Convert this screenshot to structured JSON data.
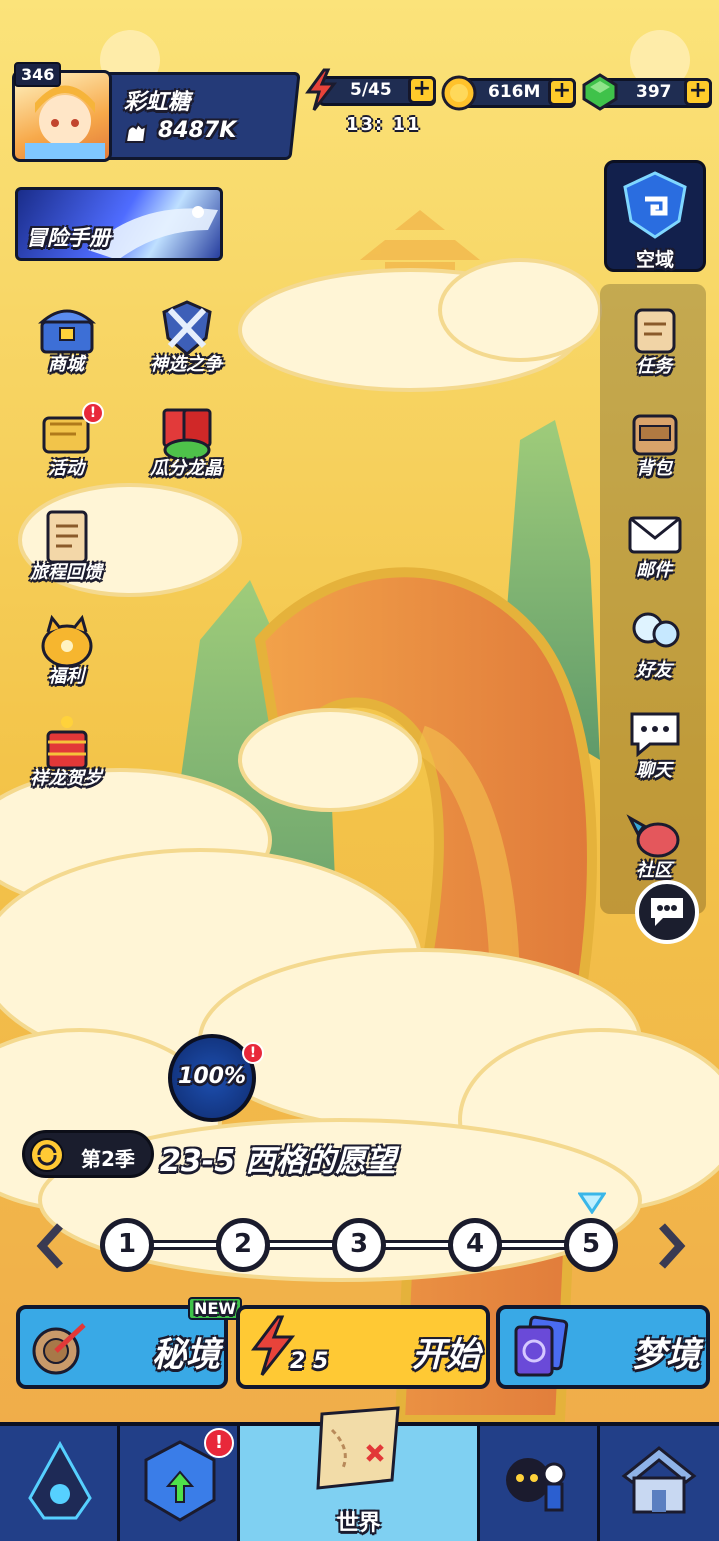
{
  "profile": {
    "level": "346",
    "nickname": "彩虹糖",
    "power": "8487K"
  },
  "resources": {
    "energy": "5/45",
    "energy_timer": "13: 11",
    "gold": "616M",
    "gems": "397"
  },
  "adventure_manual": {
    "label": "冒险手册"
  },
  "left_menu": [
    {
      "label": "商城"
    },
    {
      "label": "神选之争"
    },
    {
      "label": "活动",
      "badge": "!"
    },
    {
      "label": "瓜分龙晶"
    },
    {
      "label": "旅程回馈"
    },
    {
      "label": "福利"
    },
    {
      "label": "祥龙贺岁"
    }
  ],
  "sky_domain": {
    "label": "空域"
  },
  "right_menu": [
    {
      "label": "任务"
    },
    {
      "label": "背包"
    },
    {
      "label": "邮件"
    },
    {
      "label": "好友"
    },
    {
      "label": "聊天"
    },
    {
      "label": "社区"
    }
  ],
  "stage": {
    "progress": "100%",
    "season": "第2季",
    "name": "23-5 西格的愿望",
    "steps": [
      "1",
      "2",
      "3",
      "4",
      "5"
    ],
    "current_step": 5
  },
  "buttons": {
    "secret_realm": "秘境",
    "secret_realm_badge": "NEW",
    "start": "开始",
    "start_cost": "2 5",
    "dream_realm": "梦境"
  },
  "bottom_nav": {
    "world": "世界",
    "badge": "!"
  },
  "colors": {
    "sky": "#f6d25a",
    "panel_navy": "#223f88",
    "start_yellow": "#ffc934",
    "button_blue": "#39a9e6",
    "gold_plus": "#ffcb2b",
    "alert_red": "#e8283a"
  }
}
